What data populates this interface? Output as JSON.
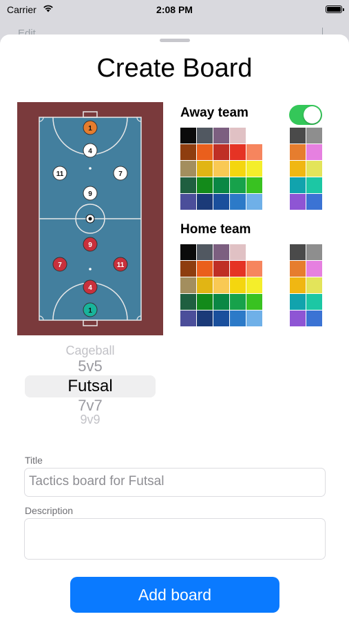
{
  "status": {
    "carrier": "Carrier",
    "time": "2:08 PM"
  },
  "background": {
    "edit_label": "Edit"
  },
  "sheet": {
    "title": "Create Board"
  },
  "court": {
    "away_players": [
      "1",
      "4",
      "11",
      "7",
      "9"
    ],
    "home_players": [
      "9",
      "7",
      "11",
      "4",
      "1"
    ],
    "ball": "⚽"
  },
  "away_team": {
    "label": "Away team",
    "toggle_on": true
  },
  "home_team": {
    "label": "Home team"
  },
  "palette_main": [
    "#0b0b0b",
    "#515861",
    "#7c5f80",
    "#e0c1c4",
    "#ffffff",
    "#8e3d0f",
    "#ea5f1c",
    "#bf2f25",
    "#e53324",
    "#f6855e",
    "#a38e5e",
    "#e1b514",
    "#f9c954",
    "#f4d60f",
    "#f4ee2b",
    "#1f5f40",
    "#138a1a",
    "#0a8744",
    "#17a24b",
    "#39c221",
    "#4b4e9a",
    "#1b3a78",
    "#1a4f9c",
    "#2c7ac8",
    "#6fb0e8"
  ],
  "palette_side": [
    "#4a4a4a",
    "#8e8e8e",
    "#e67d2e",
    "#e680e0",
    "#f0b712",
    "#e3e45a",
    "#11a3ad",
    "#1cc7a4",
    "#8e55d4",
    "#3b73d4"
  ],
  "picker": {
    "options": [
      "Cageball",
      "5v5",
      "Futsal",
      "7v7",
      "9v9"
    ],
    "selected": "Futsal"
  },
  "form": {
    "title_label": "Title",
    "title_placeholder": "Tactics board for Futsal",
    "description_label": "Description",
    "description_value": ""
  },
  "button": {
    "add_label": "Add board"
  }
}
